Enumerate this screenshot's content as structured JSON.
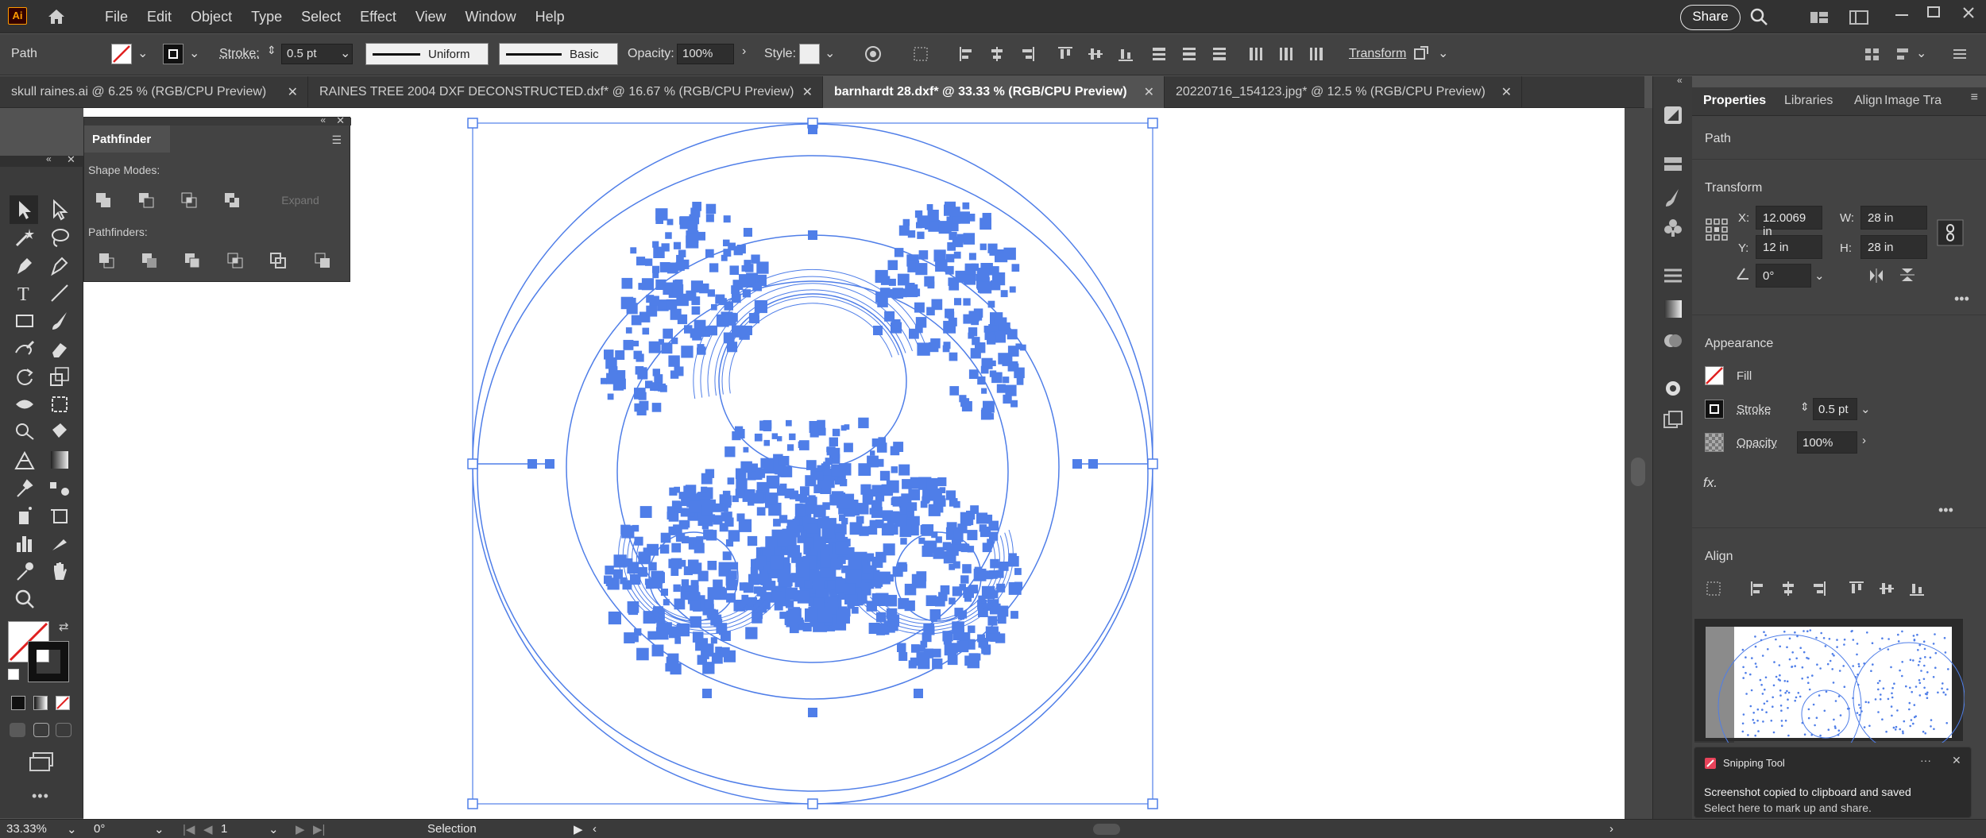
{
  "app": {
    "logo": "Ai"
  },
  "menu": [
    "File",
    "Edit",
    "Object",
    "Type",
    "Select",
    "Effect",
    "View",
    "Window",
    "Help"
  ],
  "share_label": "Share",
  "control": {
    "object_type": "Path",
    "stroke_label": "Stroke:",
    "stroke_value": "0.5 pt",
    "profile": "Uniform",
    "brush": "Basic",
    "opacity_label": "Opacity:",
    "opacity_value": "100%",
    "style_label": "Style:",
    "transform_link": "Transform"
  },
  "tabs": [
    {
      "label": "skull raines.ai @ 6.25 % (RGB/CPU Preview)",
      "active": false
    },
    {
      "label": "RAINES TREE 2004 DXF DECONSTRUCTED.dxf* @ 16.67 % (RGB/CPU Preview)",
      "active": false
    },
    {
      "label": "barnhardt 28.dxf* @ 33.33 % (RGB/CPU Preview)",
      "active": true
    },
    {
      "label": "20220716_154123.jpg* @ 12.5 % (RGB/CPU Preview)",
      "active": false
    }
  ],
  "pathfinder": {
    "title": "Pathfinder",
    "shape_modes": "Shape Modes:",
    "expand": "Expand",
    "pathfinders": "Pathfinders:"
  },
  "properties": {
    "tabs": [
      "Properties",
      "Libraries",
      "Align",
      "Image Tra"
    ],
    "object": "Path",
    "transform_title": "Transform",
    "x_label": "X:",
    "x": "12.0069 in",
    "y_label": "Y:",
    "y": "12 in",
    "w_label": "W:",
    "w": "28 in",
    "h_label": "H:",
    "h": "28 in",
    "angle": "0°",
    "appearance_title": "Appearance",
    "fill_label": "Fill",
    "stroke_label": "Stroke",
    "stroke_value": "0.5 pt",
    "opacity_label": "Opacity",
    "opacity_value": "100%",
    "fx": "fx.",
    "align_title": "Align"
  },
  "toast": {
    "app": "Snipping Tool",
    "line1": "Screenshot copied to clipboard and saved",
    "line2": "Select here to mark up and share."
  },
  "status": {
    "zoom": "33.33%",
    "rotation": "0°",
    "artboard": "1",
    "tool": "Selection"
  },
  "colors": {
    "accent": "#4f7ee8",
    "ui_bg": "#535353",
    "menubar": "#323232"
  }
}
